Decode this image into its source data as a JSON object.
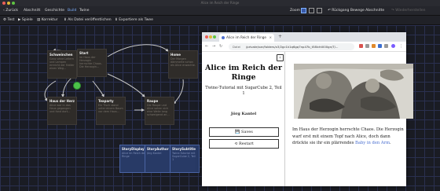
{
  "window": {
    "title": "Alice im Reich der Ringe"
  },
  "menubar": {
    "back": "Zurück",
    "items": [
      "Abschnitt",
      "Geschichte",
      "Build",
      "Twine"
    ],
    "active_item": "Build",
    "zoom_label": "Zoom",
    "undo": "Rückgang Bewege Abschnitte",
    "redo": "Wiederherstellen"
  },
  "toolbar": {
    "test": "Test",
    "play": "Spiele",
    "proof": "Korrektur",
    "publish": "Als Datei veröffentlichen",
    "export": "Exportiere als Twee"
  },
  "passages": [
    {
      "title": "Schweinchen",
      "excerpt": "Ganz ohne Leitern und Lampen erreicht der Hatter einen Weg..."
    },
    {
      "title": "Start",
      "excerpt": "Im Haus der Herzogin herrschte Chaos. Die Herzogin..."
    },
    {
      "title": "Home",
      "excerpt": "Der Morgen dämmerte schon als Alice erwachte."
    },
    {
      "title": "Haus der Herzogin",
      "excerpt": "Alice war in das Haus gegangen und fand dort..."
    },
    {
      "title": "Teaparty",
      "excerpt": "Ein Tisch stand unter einem Baum vor dem Haus..."
    },
    {
      "title": "Raupe",
      "excerpt": "Die Raupe und Alice sahen sich eine Weile lang schweigend an..."
    },
    {
      "title": "StoryDisplayTitle",
      "excerpt": "Alice im Reich der Ringe"
    },
    {
      "title": "StoryAuthor",
      "excerpt": "Jörg Kantel"
    },
    {
      "title": "StorySubtitle",
      "excerpt": "Twine-Tutorial mit SugarCube 2, Teil 1"
    }
  ],
  "browser": {
    "tab_title": "Alice im Reich der Ringe",
    "address_label": "Datei",
    "url": "/private/var/folders/x3/2gc1k1q6gq7np47b_t58lcht000gn/T/..."
  },
  "story": {
    "title": "Alice im Reich der Ringe",
    "subtitle": "Twine-Tutorial mit SugarCube 2, Teil 1",
    "author": "Jörg Kantel",
    "saves_label": "Saves",
    "restart_label": "Restart",
    "text_before_link": "Im Haus der Herzogin herrschte Chaos. Die Herzogin warf erst mit einem Topf nach Alice, doch dann drückte sie ihr ein plärrendes",
    "link_text": "Baby in den Arm",
    "text_after_link": "."
  },
  "colors": {
    "accent": "#4a6fd0",
    "grid": "#2a3050",
    "start": "#4cc24a"
  }
}
